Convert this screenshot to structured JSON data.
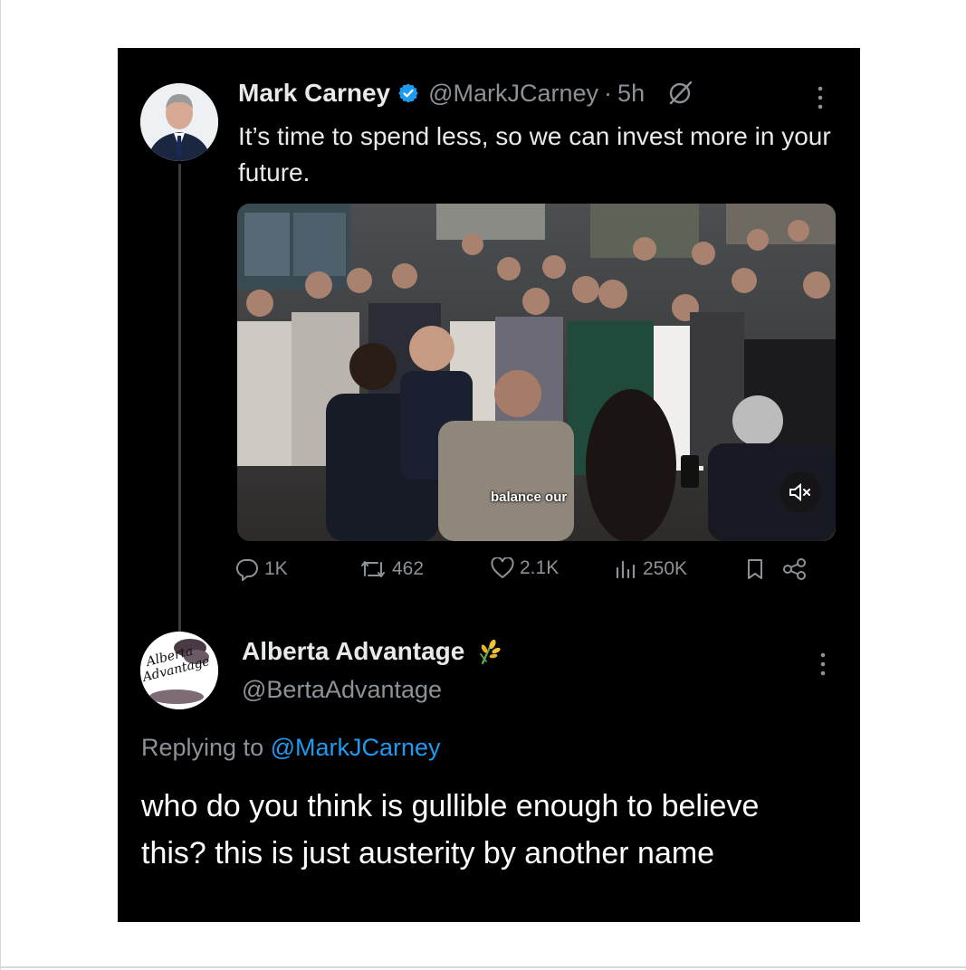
{
  "tweet": {
    "author_name": "Mark Carney",
    "author_handle": "@MarkJCarney",
    "time_separator": "·",
    "time_ago": "5h",
    "text": "It’s time to spend less, so we can invest more in your future.",
    "video_caption": "balance our",
    "stats": {
      "replies": "1K",
      "reposts": "462",
      "likes": "2.1K",
      "views": "250K"
    }
  },
  "reply": {
    "author_name": "Alberta Advantage",
    "author_handle": "@BertaAdvantage",
    "avatar_text_line1": "Alberta",
    "avatar_text_line2": "Advantage",
    "replying_prefix": "Replying to",
    "replying_to": "@MarkJCarney",
    "text": "who do you think is gullible enough to believe this? this is just austerity by another name"
  },
  "icons": {
    "verified": "verified-badge-icon",
    "grok": "grok-icon",
    "more": "more-dots-icon",
    "reply": "reply-icon",
    "repost": "repost-icon",
    "like": "heart-icon",
    "views": "views-icon",
    "bookmark": "bookmark-icon",
    "share": "share-icon",
    "mute": "mute-icon",
    "wheat": "wheat-emoji-icon"
  },
  "colors": {
    "background": "#000000",
    "text": "#e7e9ea",
    "muted": "#8b9298",
    "link": "#1d9bf0",
    "verified": "#1d9bf0"
  }
}
